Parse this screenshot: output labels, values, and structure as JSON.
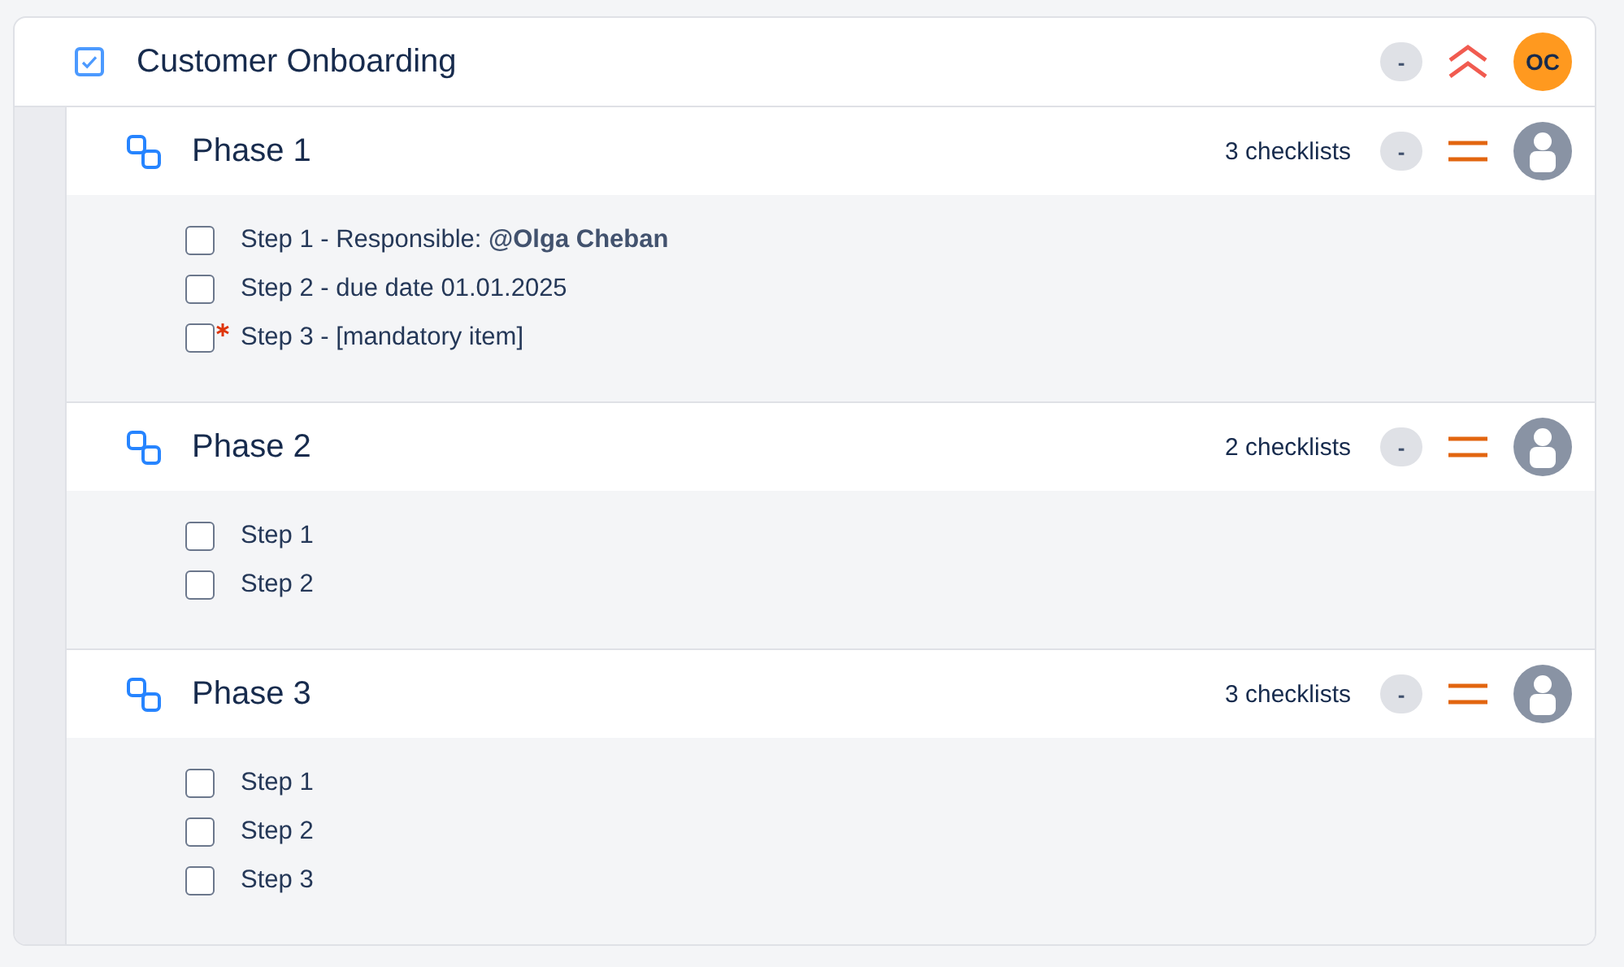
{
  "issue": {
    "title": "Customer Onboarding",
    "checked": true,
    "status": "-",
    "priority_icon": {
      "kind": "highest"
    },
    "assignee": {
      "kind": "initials",
      "initials": "OC"
    }
  },
  "phases": [
    {
      "title": "Phase 1",
      "count": "3 checklists",
      "status": "-",
      "priority_icon": {
        "kind": "medium"
      },
      "assignee": {
        "kind": "placeholder"
      },
      "steps": [
        {
          "text": "Step 1 - Responsible: **@Olga Cheban**",
          "checked": false,
          "required": false
        },
        {
          "text": "Step 2 - due date 01.01.2025",
          "checked": false,
          "required": false
        },
        {
          "text": "Step 3 - [mandatory item]",
          "checked": false,
          "required": true
        }
      ]
    },
    {
      "title": "Phase 2",
      "count": "2 checklists",
      "status": "-",
      "priority_icon": {
        "kind": "medium"
      },
      "assignee": {
        "kind": "placeholder"
      },
      "steps": [
        {
          "text": "Step 1",
          "checked": false,
          "required": false
        },
        {
          "text": "Step 2",
          "checked": false,
          "required": false
        }
      ]
    },
    {
      "title": "Phase 3",
      "count": "3 checklists",
      "status": "-",
      "priority_icon": {
        "kind": "medium"
      },
      "assignee": {
        "kind": "placeholder"
      },
      "steps": [
        {
          "text": "Step 1",
          "checked": false,
          "required": false
        },
        {
          "text": "Step 2",
          "checked": false,
          "required": false
        },
        {
          "text": "Step 3",
          "checked": false,
          "required": false
        }
      ]
    }
  ]
}
